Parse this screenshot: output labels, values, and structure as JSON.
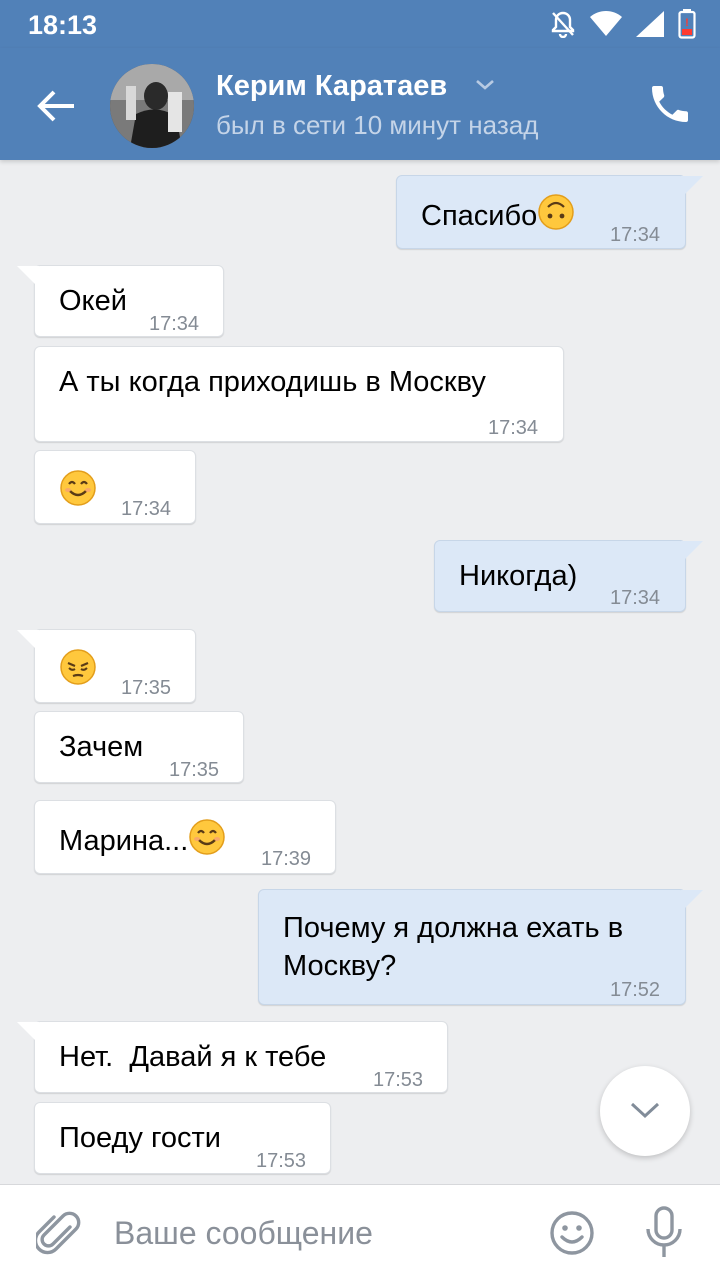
{
  "status_bar": {
    "time": "18:13"
  },
  "header": {
    "contact_name": "Керим Каратаев",
    "last_seen": "был в сети 10 минут назад"
  },
  "messages": [
    {
      "dir": "out",
      "text": "Спасибо",
      "emoji": "upside-down-face",
      "time": "17:34"
    },
    {
      "dir": "in",
      "text": "Окей",
      "time": "17:34"
    },
    {
      "dir": "in",
      "text": "А ты когда приходишь в Москву",
      "time": "17:34"
    },
    {
      "dir": "in",
      "text": "",
      "emoji": "smiling-face",
      "time": "17:34"
    },
    {
      "dir": "out",
      "text": "Никогда)",
      "time": "17:34"
    },
    {
      "dir": "in",
      "text": "",
      "emoji": "pensive-face",
      "time": "17:35"
    },
    {
      "dir": "in",
      "text": "Зачем",
      "time": "17:35"
    },
    {
      "dir": "in",
      "text": "Марина...",
      "emoji": "smiling-face",
      "time": "17:39"
    },
    {
      "dir": "out",
      "text": "Почему я должна ехать в",
      "text2": "Москву?",
      "time": "17:52"
    },
    {
      "dir": "in",
      "text": "Нет.  Давай я к тебе",
      "time": "17:53"
    },
    {
      "dir": "in",
      "text": "Поеду гости",
      "time": "17:53"
    }
  ],
  "composer": {
    "placeholder": "Ваше сообщение"
  },
  "colors": {
    "header_bg": "#5181b8",
    "bubble_out": "#dce8f7",
    "bubble_in": "#ffffff",
    "chat_bg": "#edeef0"
  }
}
